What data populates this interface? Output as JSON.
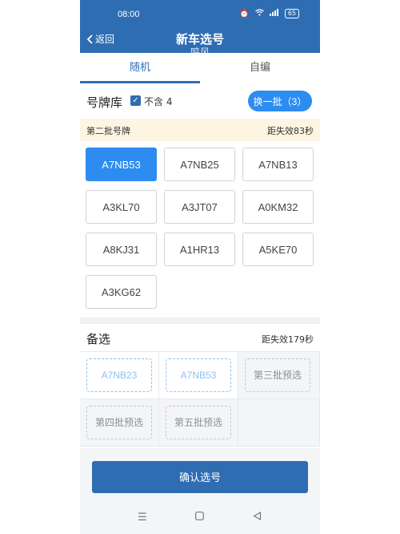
{
  "status": {
    "time": "08:00",
    "battery": "65"
  },
  "nav": {
    "back_label": "返回",
    "title": "新车选号",
    "subtitle": "鸣风"
  },
  "tabs": [
    {
      "label": "随机"
    },
    {
      "label": "自编"
    }
  ],
  "pool": {
    "label": "号牌库",
    "exclude_label": "不含 4",
    "refresh_label": "换一批（3）"
  },
  "batch": {
    "label": "第二批号牌",
    "countdown": "距失效83秒"
  },
  "plates": [
    "A7NB53",
    "A7NB25",
    "A7NB13",
    "A3KL70",
    "A3JT07",
    "A0KM32",
    "A8KJ31",
    "A1HR13",
    "A5KE70",
    "A3KG62"
  ],
  "selected_plate": "A7NB53",
  "alternates": {
    "label": "备选",
    "countdown": "距失效179秒",
    "slots": [
      "A7NB23",
      "A7NB53",
      "第三批预选",
      "第四批预选",
      "第五批预选"
    ]
  },
  "confirm_label": "确认选号",
  "colors": {
    "primary": "#2f6db3",
    "accent": "#2d8cf0",
    "banner": "#fdf5e2"
  }
}
